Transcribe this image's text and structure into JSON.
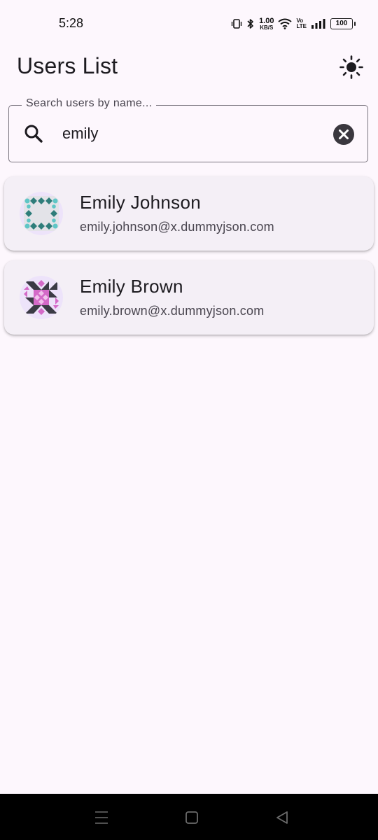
{
  "status_bar": {
    "time": "5:28",
    "net_speed_value": "1.00",
    "net_speed_unit": "KB/S",
    "volte_top": "Vo",
    "volte_bottom": "LTE",
    "battery": "100",
    "icons": [
      "vibrate-icon",
      "bluetooth-icon",
      "wifi-icon",
      "signal-icon",
      "battery-icon"
    ]
  },
  "app_bar": {
    "title": "Users List",
    "theme_icon": "sun-icon"
  },
  "search": {
    "label": "Search users by name...",
    "value": "emily",
    "icon": "search-icon",
    "clear_icon": "clear-icon"
  },
  "users": [
    {
      "name": "Emily Johnson",
      "email": "emily.johnson@x.dummyjson.com",
      "avatar_colors": [
        "#2e7d7a",
        "#5fc6c6",
        "#e3e3e8"
      ]
    },
    {
      "name": "Emily Brown",
      "email": "emily.brown@x.dummyjson.com",
      "avatar_colors": [
        "#3b3b45",
        "#d46ac8",
        "#f1c2ec"
      ]
    }
  ],
  "nav_bar": {
    "icons": [
      "menu-icon",
      "home-icon",
      "back-icon"
    ]
  },
  "colors": {
    "background": "#fdf7fd",
    "card": "#f4eff6",
    "outline": "#79747e",
    "text_primary": "#1d1b20",
    "text_secondary": "#49454f"
  }
}
